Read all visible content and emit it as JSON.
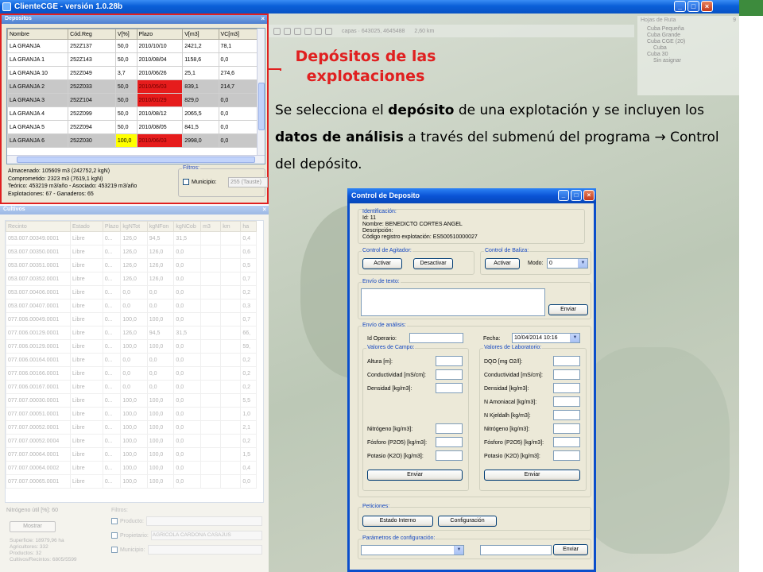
{
  "window": {
    "title": "ClienteCGE - versión 1.0.28b",
    "buttons": [
      "_",
      "□",
      "×"
    ]
  },
  "map": {
    "toolbar_coords": "capas · 643025, 4645488",
    "toolbar_scale": "2,60 km",
    "hojas_ruta": {
      "title": "Hojas de Ruta",
      "count": "9",
      "items": [
        {
          "label": "Cuba Pequeña",
          "sub": false
        },
        {
          "label": "Cuba Grande",
          "sub": false
        },
        {
          "label": "Cuba CGE (20)",
          "sub": false
        },
        {
          "label": "Cuba",
          "sub": true
        },
        {
          "label": "Cuba 30",
          "sub": false
        },
        {
          "label": "Sin asignar",
          "sub": true
        }
      ]
    }
  },
  "depositos": {
    "title": "Depositos",
    "columns": [
      "Nombre",
      "Cód.Reg",
      "V[%]",
      "Plazo",
      "V[m3]",
      "VC[m3]"
    ],
    "rows": [
      {
        "cells": [
          "LA GRANJA",
          "252Z137",
          "50,0",
          "2010/10/10",
          "2421,2",
          "78,1"
        ],
        "selected": false,
        "plazo_color": "",
        "vpct_color": ""
      },
      {
        "cells": [
          "LA GRANJA 1",
          "252Z143",
          "50,0",
          "2010/08/04",
          "1158,6",
          "0,0"
        ],
        "selected": false,
        "plazo_color": "",
        "vpct_color": ""
      },
      {
        "cells": [
          "LA GRANJA 10",
          "252Z049",
          "3,7",
          "2010/06/26",
          "25,1",
          "274,6"
        ],
        "selected": false,
        "plazo_color": "",
        "vpct_color": ""
      },
      {
        "cells": [
          "LA GRANJA 2",
          "252Z033",
          "50,0",
          "2010/05/03",
          "839,1",
          "214,7"
        ],
        "selected": true,
        "plazo_color": "red",
        "vpct_color": ""
      },
      {
        "cells": [
          "LA GRANJA 3",
          "252Z104",
          "50,0",
          "2010/01/29",
          "829,0",
          "0,0"
        ],
        "selected": true,
        "plazo_color": "red",
        "vpct_color": ""
      },
      {
        "cells": [
          "LA GRANJA 4",
          "252Z099",
          "50,0",
          "2010/08/12",
          "2065,5",
          "0,0"
        ],
        "selected": false,
        "plazo_color": "",
        "vpct_color": ""
      },
      {
        "cells": [
          "LA GRANJA 5",
          "252Z094",
          "50,0",
          "2010/08/05",
          "841,5",
          "0,0"
        ],
        "selected": false,
        "plazo_color": "",
        "vpct_color": ""
      },
      {
        "cells": [
          "LA GRANJA 6",
          "252Z030",
          "100,0",
          "2010/06/03",
          "2998,0",
          "0,0"
        ],
        "selected": true,
        "plazo_color": "red",
        "vpct_color": "yellow"
      }
    ],
    "info": [
      "Almacenado: 105609 m3 (242752,2 kgN)",
      "Comprometido: 2323 m3 (7619,1 kgN)",
      "Teórico: 453219 m3/año - Asociado: 453219 m3/año",
      "Explotaciones: 67 - Ganaderos: 65"
    ],
    "filtros_label": "Filtros:",
    "municipio_label": "Municipio:",
    "municipio_value": "255 (Tauste)"
  },
  "cultivos": {
    "title": "Cultivos",
    "columns": [
      "Recinto",
      "Estado",
      "Plazo",
      "kgNTot",
      "kgNFon",
      "kgNCob",
      "m3",
      "km",
      "ha"
    ],
    "rows": [
      [
        "053.007.00349.0001",
        "Libre",
        "0...",
        "126,0",
        "94,5",
        "31,5",
        "",
        "",
        "0,4"
      ],
      [
        "053.007.00350.0001",
        "Libre",
        "0...",
        "126,0",
        "126,0",
        "0,0",
        "",
        "",
        "0,6"
      ],
      [
        "053.007.00351.0001",
        "Libre",
        "0...",
        "126,0",
        "126,0",
        "0,0",
        "",
        "",
        "0,5"
      ],
      [
        "053.007.00352.0001",
        "Libre",
        "0...",
        "126,0",
        "126,0",
        "0,0",
        "",
        "",
        "0,7"
      ],
      [
        "053.007.00406.0001",
        "Libre",
        "0...",
        "0,0",
        "0,0",
        "0,0",
        "",
        "",
        "0,2"
      ],
      [
        "053.007.00407.0001",
        "Libre",
        "0...",
        "0,0",
        "0,0",
        "0,0",
        "",
        "",
        "0,3"
      ],
      [
        "077.006.00049.0001",
        "Libre",
        "0...",
        "100,0",
        "100,0",
        "0,0",
        "",
        "",
        "0,7"
      ],
      [
        "077.006.00129.0001",
        "Libre",
        "0...",
        "126,0",
        "94,5",
        "31,5",
        "",
        "",
        "66,"
      ],
      [
        "077.006.00129.0001",
        "Libre",
        "0...",
        "100,0",
        "100,0",
        "0,0",
        "",
        "",
        "59,"
      ],
      [
        "077.006.00164.0001",
        "Libre",
        "0...",
        "0,0",
        "0,0",
        "0,0",
        "",
        "",
        "0,2"
      ],
      [
        "077.006.00166.0001",
        "Libre",
        "0...",
        "0,0",
        "0,0",
        "0,0",
        "",
        "",
        "0,2"
      ],
      [
        "077.006.00167.0001",
        "Libre",
        "0...",
        "0,0",
        "0,0",
        "0,0",
        "",
        "",
        "0,2"
      ],
      [
        "077.007.00030.0001",
        "Libre",
        "0...",
        "100,0",
        "100,0",
        "0,0",
        "",
        "",
        "5,5"
      ],
      [
        "077.007.00051.0001",
        "Libre",
        "0...",
        "100,0",
        "100,0",
        "0,0",
        "",
        "",
        "1,0"
      ],
      [
        "077.007.00052.0001",
        "Libre",
        "0...",
        "100,0",
        "100,0",
        "0,0",
        "",
        "",
        "2,1"
      ],
      [
        "077.007.00052.0004",
        "Libre",
        "0...",
        "100,0",
        "100,0",
        "0,0",
        "",
        "",
        "0,2"
      ],
      [
        "077.007.00064.0001",
        "Libre",
        "0...",
        "100,0",
        "100,0",
        "0,0",
        "",
        "",
        "1,5"
      ],
      [
        "077.007.00064.0002",
        "Libre",
        "0...",
        "100,0",
        "100,0",
        "0,0",
        "",
        "",
        "0,4"
      ],
      [
        "077.007.00065.0001",
        "Libre",
        "0...",
        "100,0",
        "100,0",
        "0,0",
        "",
        "",
        "0,0"
      ]
    ],
    "nitrogeno_label": "Nitrógeno útil [%]:",
    "nitrogeno_value": "60",
    "mostrar_label": "Mostrar",
    "filtros_label": "Filtros:",
    "producto_label": "Producto:",
    "propietario_label": "Propietario:",
    "propietario_value": "AGRICOLA CARDONA CASAJUS",
    "municipio_label": "Municipio:",
    "info": [
      "Superficie: 18979,96 ha",
      "Agricultores: 332",
      "Productos: 32",
      "Cultivos/Recintos: 6805/5599"
    ]
  },
  "annotation": {
    "title_line1": "Depósitos de las",
    "title_line2": "explotaciones",
    "text_1": "Se selecciona el ",
    "text_bold_1": "depósito",
    "text_2": " de una explotación y se incluyen los ",
    "text_bold_2": "datos de análisis",
    "text_3": " a través del submenú del programa  ",
    "arrow": "→",
    "text_4": " Control del depósito.",
    "accent_color": "#e02020"
  },
  "dialog": {
    "title": "Control de Deposito",
    "identificacion": {
      "caption": "Identificación:",
      "id": "Id: 11",
      "nombre": "Nombre: BENEDICTO CORTES ANGEL",
      "descripcion": "Descripción:",
      "codigo": "Código registro explotación: ES500510000027"
    },
    "agitador": {
      "caption": "Control de Agitador:",
      "activar": "Activar",
      "desactivar": "Desactivar"
    },
    "baliza": {
      "caption": "Control de Baliza:",
      "activar": "Activar",
      "modo_label": "Modo:",
      "modo_value": "0"
    },
    "envio_texto": {
      "caption": "Envío de texto:",
      "enviar": "Enviar"
    },
    "envio_analisis": {
      "caption": "Envío de análisis:",
      "id_operario_label": "Id Operario:",
      "fecha_label": "Fecha:",
      "fecha_value": "10/04/2014 10:16",
      "campo": {
        "caption": "Valores de Campo:",
        "fields": [
          "Altura [m]:",
          "Conductividad [mS/cm]:",
          "Densidad [kg/m3]:"
        ],
        "fields_bottom": [
          "Nitrógeno [kg/m3]:",
          "Fósforo (P2O5) [kg/m3]:",
          "Potasio (K2O) [kg/m3]:"
        ],
        "enviar": "Enviar"
      },
      "laboratorio": {
        "caption": "Valores de Laboratorio:",
        "fields": [
          "DQO [mg O2/l]:",
          "Conductividad [mS/cm]:",
          "Densidad [kg/m3]:",
          "N Amoniacal [kg/m3]:",
          "N Kjeldalh [kg/m3]:",
          "Nitrógeno [kg/m3]:",
          "Fósforo (P2O5) [kg/m3]:",
          "Potasio (K2O) [kg/m3]:"
        ],
        "enviar": "Enviar"
      }
    },
    "peticiones": {
      "caption": "Peticiones:",
      "estado": "Estado Interno",
      "configuracion": "Configuración"
    },
    "parametros": {
      "caption": "Parámetros de configuración:",
      "enviar": "Enviar"
    }
  }
}
